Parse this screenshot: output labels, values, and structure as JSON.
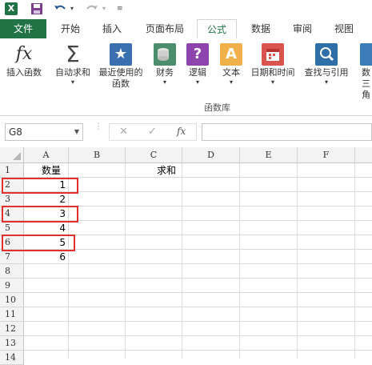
{
  "title_bar": {
    "app_icon": "excel-icon",
    "save_icon": "save-icon",
    "undo_icon": "undo-icon",
    "redo_icon": "redo-icon",
    "customize_icon": "customize-icon"
  },
  "tabs": [
    {
      "label": "文件",
      "state": "file"
    },
    {
      "label": "开始"
    },
    {
      "label": "插入"
    },
    {
      "label": "页面布局"
    },
    {
      "label": "公式",
      "state": "active"
    },
    {
      "label": "数据"
    },
    {
      "label": "审阅"
    },
    {
      "label": "视图"
    }
  ],
  "ribbon": {
    "buttons": [
      {
        "label": "插入函数",
        "icon": "function-icon"
      },
      {
        "label": "自动求和",
        "icon": "sigma-icon"
      },
      {
        "label": "最近使用的\n函数",
        "icon": "star-icon",
        "color": "#3a6fb0"
      },
      {
        "label": "财务",
        "icon": "coins-icon",
        "color": "#4b8d6c"
      },
      {
        "label": "逻辑",
        "icon": "question-icon",
        "color": "#8e44ad"
      },
      {
        "label": "文本",
        "icon": "text-a-icon",
        "color": "#e6a33a"
      },
      {
        "label": "日期和时间",
        "icon": "calendar-icon",
        "color": "#d9534f"
      },
      {
        "label": "查找与引用",
        "icon": "search-icon",
        "color": "#2f6fa8"
      },
      {
        "label": "数\n三角",
        "icon": "math-icon"
      }
    ],
    "group_label": "函数库"
  },
  "formula_bar": {
    "name_box": "G8",
    "cancel": "✕",
    "confirm": "✓",
    "fx": "fx",
    "value": ""
  },
  "grid": {
    "columns": [
      "A",
      "B",
      "C",
      "D",
      "E",
      "F"
    ],
    "rows": [
      "1",
      "2",
      "3",
      "4",
      "5",
      "6",
      "7",
      "8",
      "9",
      "10",
      "11",
      "12",
      "13",
      "14"
    ],
    "cells": {
      "A1": "数量",
      "C1": "求和",
      "A2": "1",
      "A3": "2",
      "A4": "3",
      "A5": "4",
      "A6": "5",
      "A7": "6"
    }
  },
  "colors": {
    "accent": "#217346",
    "highlight": "#e0312f"
  }
}
